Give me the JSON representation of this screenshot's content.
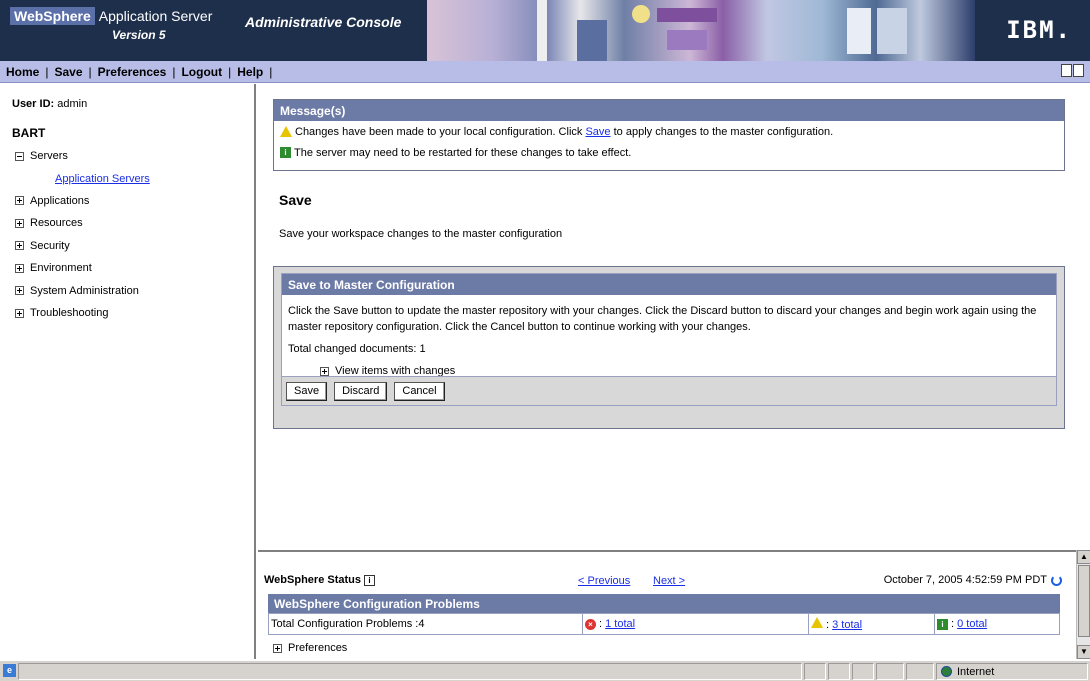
{
  "banner": {
    "brand_websphere": "WebSphere",
    "brand_app_server": "Application Server",
    "version": "Version 5",
    "console_title": "Administrative Console",
    "ibm_logo": "IBM."
  },
  "navbar": {
    "home": "Home",
    "save": "Save",
    "preferences": "Preferences",
    "logout": "Logout",
    "help": "Help",
    "separator": "|"
  },
  "leftnav": {
    "user_label": "User ID:",
    "user_value": "admin",
    "cell_name": "BART",
    "items": [
      {
        "label": "Servers",
        "expanded": true
      },
      {
        "label": "Application Servers",
        "sub": true
      },
      {
        "label": "Applications",
        "expanded": false
      },
      {
        "label": "Resources",
        "expanded": false
      },
      {
        "label": "Security",
        "expanded": false
      },
      {
        "label": "Environment",
        "expanded": false
      },
      {
        "label": "System Administration",
        "expanded": false
      },
      {
        "label": "Troubleshooting",
        "expanded": false
      }
    ]
  },
  "messages": {
    "header": "Message(s)",
    "warning_pre": "Changes have been made to your local configuration. Click",
    "warning_link": "Save",
    "warning_post": "to apply changes to the master configuration.",
    "info": "The server may need to be restarted for these changes to take effect."
  },
  "page": {
    "title": "Save",
    "description": "Save your workspace changes to the master configuration"
  },
  "save_panel": {
    "header": "Save to Master Configuration",
    "description": "Click the Save button to update the master repository with your changes. Click the Discard button to discard your changes and begin work again using the master repository configuration. Click the Cancel button to continue working with your changes.",
    "total_changed": "Total changed documents: 1",
    "view_items": "View items with changes",
    "buttons": {
      "save": "Save",
      "discard": "Discard",
      "cancel": "Cancel"
    }
  },
  "status": {
    "title": "WebSphere Status",
    "prev": "< Previous",
    "next": "Next >",
    "timestamp": "October 7, 2005 4:52:59 PM PDT",
    "problems_header": "WebSphere Configuration Problems",
    "total_problems": "Total Configuration Problems :4",
    "errors_prefix": ":",
    "errors": "1 total",
    "warnings_prefix": ":",
    "warnings": "3 total",
    "infos_prefix": ":",
    "infos": "0 total",
    "preferences": "Preferences"
  },
  "browser": {
    "zone": "Internet"
  },
  "colors": {
    "banner_bg": "#1e2f4b",
    "navbar_bg": "#b7bde6",
    "section_header": "#6c7aa6",
    "link": "#1a2ee6"
  }
}
